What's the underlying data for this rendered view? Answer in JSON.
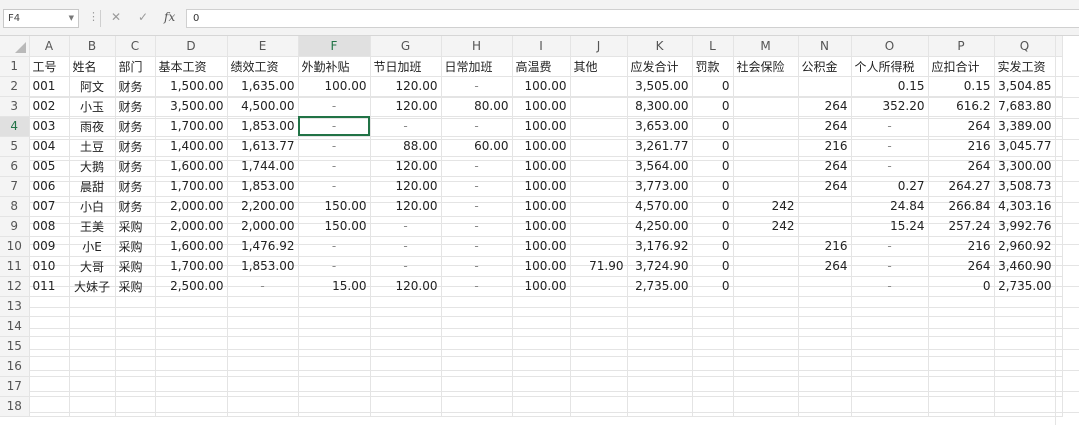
{
  "formula_bar": {
    "name_box": "F4",
    "formula": "0"
  },
  "sheet": {
    "columns": [
      "A",
      "B",
      "C",
      "D",
      "E",
      "F",
      "G",
      "H",
      "I",
      "J",
      "K",
      "L",
      "M",
      "N",
      "O",
      "P",
      "Q"
    ],
    "selected_column": "F",
    "selected_row": "4",
    "row_numbers": [
      "1",
      "2",
      "3",
      "4",
      "5",
      "6",
      "7",
      "8",
      "9",
      "10",
      "11",
      "12",
      "13",
      "14",
      "15",
      "16",
      "17",
      "18"
    ],
    "header_row": [
      "工号",
      "姓名",
      "部门",
      "基本工资",
      "绩效工资",
      "外勤补贴",
      "节日加班",
      "日常加班",
      "高温费",
      "其他",
      "应发合计",
      "罚款",
      "社会保险",
      "公积金",
      "个人所得税",
      "应扣合计",
      "实发工资"
    ],
    "rows": [
      [
        "001",
        "阿文",
        "财务",
        "1,500.00",
        "1,635.00",
        "100.00",
        "120.00",
        "-",
        "100.00",
        "",
        "3,505.00",
        "0",
        "",
        "",
        "0.15",
        "0.15",
        "3,504.85"
      ],
      [
        "002",
        "小玉",
        "财务",
        "3,500.00",
        "4,500.00",
        "-",
        "120.00",
        "80.00",
        "100.00",
        "",
        "8,300.00",
        "0",
        "",
        "264",
        "352.20",
        "616.2",
        "7,683.80"
      ],
      [
        "003",
        "雨夜",
        "财务",
        "1,700.00",
        "1,853.00",
        "-",
        "-",
        "-",
        "100.00",
        "",
        "3,653.00",
        "0",
        "",
        "264",
        "-",
        "264",
        "3,389.00"
      ],
      [
        "004",
        "土豆",
        "财务",
        "1,400.00",
        "1,613.77",
        "-",
        "88.00",
        "60.00",
        "100.00",
        "",
        "3,261.77",
        "0",
        "",
        "216",
        "-",
        "216",
        "3,045.77"
      ],
      [
        "005",
        "大鹅",
        "财务",
        "1,600.00",
        "1,744.00",
        "-",
        "120.00",
        "-",
        "100.00",
        "",
        "3,564.00",
        "0",
        "",
        "264",
        "-",
        "264",
        "3,300.00"
      ],
      [
        "006",
        "晨甜",
        "财务",
        "1,700.00",
        "1,853.00",
        "-",
        "120.00",
        "-",
        "100.00",
        "",
        "3,773.00",
        "0",
        "",
        "264",
        "0.27",
        "264.27",
        "3,508.73"
      ],
      [
        "007",
        "小白",
        "财务",
        "2,000.00",
        "2,200.00",
        "150.00",
        "120.00",
        "-",
        "100.00",
        "",
        "4,570.00",
        "0",
        "242",
        "",
        "24.84",
        "266.84",
        "4,303.16"
      ],
      [
        "008",
        "王美",
        "采购",
        "2,000.00",
        "2,000.00",
        "150.00",
        "-",
        "-",
        "100.00",
        "",
        "4,250.00",
        "0",
        "242",
        "",
        "15.24",
        "257.24",
        "3,992.76"
      ],
      [
        "009",
        "小E",
        "采购",
        "1,600.00",
        "1,476.92",
        "-",
        "-",
        "-",
        "100.00",
        "",
        "3,176.92",
        "0",
        "",
        "216",
        "-",
        "216",
        "2,960.92"
      ],
      [
        "010",
        "大哥",
        "采购",
        "1,700.00",
        "1,853.00",
        "-",
        "-",
        "-",
        "100.00",
        "71.90",
        "3,724.90",
        "0",
        "",
        "264",
        "-",
        "264",
        "3,460.90"
      ],
      [
        "011",
        "大妹子",
        "采购",
        "2,500.00",
        "-",
        "15.00",
        "120.00",
        "-",
        "100.00",
        "",
        "2,735.00",
        "0",
        "",
        "",
        "-",
        "0",
        "2,735.00"
      ]
    ]
  }
}
